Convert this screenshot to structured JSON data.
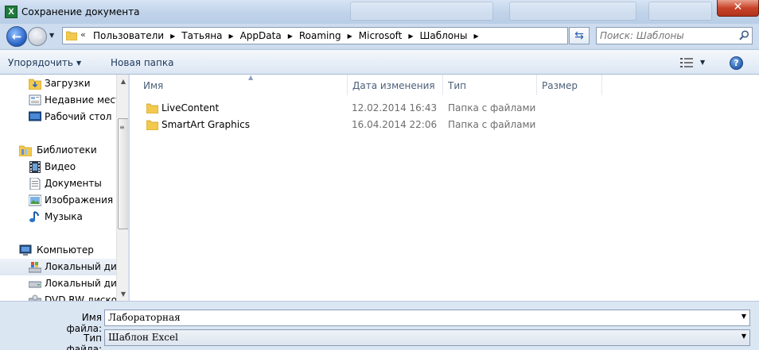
{
  "window": {
    "title": "Сохранение документа",
    "app_icon_letter": "X",
    "close_glyph": "✕"
  },
  "nav": {
    "back_glyph": "←",
    "forward_glyph": "→",
    "overflow_glyph": "«",
    "breadcrumbs": [
      "Пользователи",
      "Татьяна",
      "AppData",
      "Roaming",
      "Microsoft",
      "Шаблоны"
    ],
    "search_placeholder": "Поиск: Шаблоны"
  },
  "toolbar": {
    "organize_label": "Упорядочить",
    "new_folder_label": "Новая папка",
    "help_glyph": "?"
  },
  "sidebar": {
    "items": [
      {
        "label": "Загрузки",
        "icon": "downloads-folder-icon"
      },
      {
        "label": "Недавние места",
        "icon": "recent-places-icon"
      },
      {
        "label": "Рабочий стол",
        "icon": "desktop-icon"
      },
      {
        "label": "Библиотеки",
        "icon": "libraries-icon"
      },
      {
        "label": "Видео",
        "icon": "video-icon"
      },
      {
        "label": "Документы",
        "icon": "documents-icon"
      },
      {
        "label": "Изображения",
        "icon": "pictures-icon"
      },
      {
        "label": "Музыка",
        "icon": "music-icon"
      },
      {
        "label": "Компьютер",
        "icon": "computer-icon"
      },
      {
        "label": "Локальный диск",
        "icon": "system-drive-icon"
      },
      {
        "label": "Локальный диск",
        "icon": "drive-icon"
      },
      {
        "label": "DVD RW дисковод",
        "icon": "dvd-drive-icon"
      }
    ]
  },
  "columns": {
    "name": "Имя",
    "date": "Дата изменения",
    "type": "Тип",
    "size": "Размер"
  },
  "files": [
    {
      "name": "LiveContent",
      "date": "12.02.2014 16:43",
      "type": "Папка с файлами",
      "size": ""
    },
    {
      "name": "SmartArt Graphics",
      "date": "16.04.2014 22:06",
      "type": "Папка с файлами",
      "size": ""
    }
  ],
  "form": {
    "filename_label": "Имя файла:",
    "filename_value": "Лабораторная",
    "filetype_label": "Тип файла:",
    "filetype_value": "Шаблон Excel"
  },
  "colors": {
    "accent": "#2b64c7",
    "folder": "#f2c94c",
    "selection": "#dfe7f1"
  }
}
